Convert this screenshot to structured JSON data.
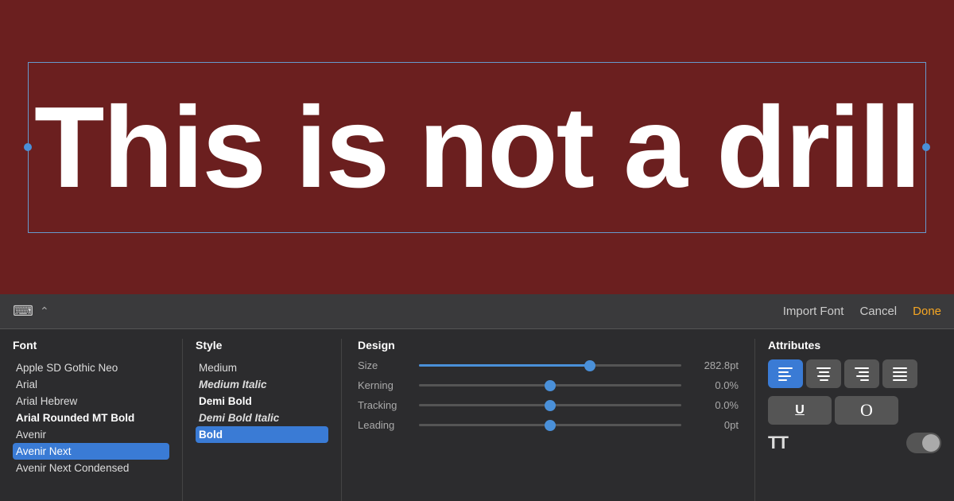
{
  "canvas": {
    "main_text": "This is not a drill",
    "background_color": "#6B1F1F"
  },
  "toolbar": {
    "import_font_label": "Import Font",
    "cancel_label": "Cancel",
    "done_label": "Done"
  },
  "font_panel": {
    "header": "Font",
    "items": [
      {
        "label": "Apple SD Gothic Neo",
        "bold": false,
        "selected": false
      },
      {
        "label": "Arial",
        "bold": false,
        "selected": false
      },
      {
        "label": "Arial Hebrew",
        "bold": false,
        "selected": false
      },
      {
        "label": "Arial Rounded MT Bold",
        "bold": true,
        "selected": false
      },
      {
        "label": "Avenir",
        "bold": false,
        "selected": false
      },
      {
        "label": "Avenir Next",
        "bold": false,
        "selected": true
      },
      {
        "label": "Avenir Next Condensed",
        "bold": false,
        "selected": false
      }
    ]
  },
  "style_panel": {
    "header": "Style",
    "items": [
      {
        "label": "Medium",
        "bold": false,
        "italic": false,
        "selected": false
      },
      {
        "label": "Medium Italic",
        "bold": false,
        "italic": true,
        "selected": false
      },
      {
        "label": "Demi Bold",
        "bold": true,
        "italic": false,
        "selected": false
      },
      {
        "label": "Demi Bold Italic",
        "bold": true,
        "italic": true,
        "selected": false
      },
      {
        "label": "Bold",
        "bold": true,
        "italic": false,
        "selected": true
      }
    ]
  },
  "design_panel": {
    "header": "Design",
    "rows": [
      {
        "label": "Size",
        "value": "282.8pt",
        "slider_pct": 65
      },
      {
        "label": "Kerning",
        "value": "0.0%",
        "slider_pct": 50
      },
      {
        "label": "Tracking",
        "value": "0.0%",
        "slider_pct": 50
      },
      {
        "label": "Leading",
        "value": "0pt",
        "slider_pct": 50
      }
    ]
  },
  "attributes_panel": {
    "header": "Attributes",
    "alignment_buttons": [
      {
        "id": "align-left",
        "label": "Align Left",
        "active": true
      },
      {
        "id": "align-center",
        "label": "Align Center",
        "active": false
      },
      {
        "id": "align-right",
        "label": "Align Right",
        "active": false
      },
      {
        "id": "align-justify",
        "label": "Justify",
        "active": false
      }
    ],
    "underline_label": "U",
    "oval_label": "O",
    "capitalize_label": "TT",
    "toggle_state": false
  }
}
